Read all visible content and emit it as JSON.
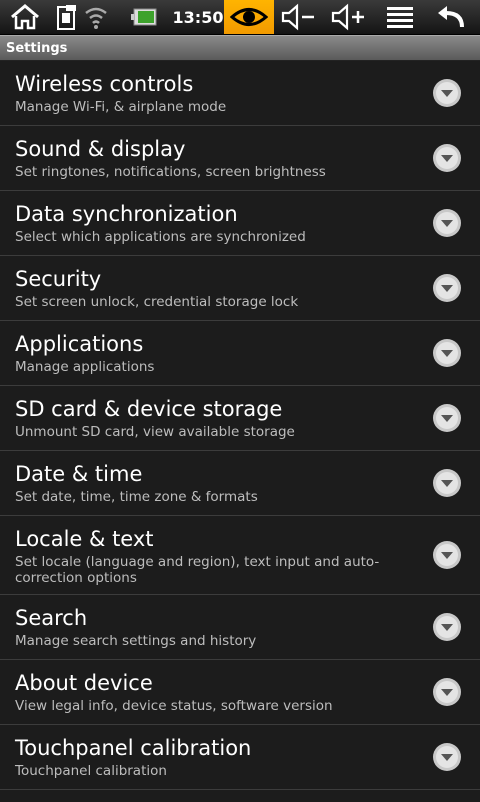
{
  "status_bar": {
    "time": "13:50",
    "icons": [
      "home-icon",
      "network-icon",
      "wifi-icon",
      "battery-icon",
      "eye-icon",
      "volume-down-icon",
      "volume-up-icon",
      "menu-icon",
      "back-icon"
    ],
    "accent": "#f5a000"
  },
  "title_bar": {
    "title": "Settings"
  },
  "settings": {
    "items": [
      {
        "title": "Wireless controls",
        "subtitle": "Manage Wi-Fi, & airplane mode"
      },
      {
        "title": "Sound & display",
        "subtitle": "Set ringtones, notifications, screen brightness"
      },
      {
        "title": "Data synchronization",
        "subtitle": "Select which applications are synchronized"
      },
      {
        "title": "Security",
        "subtitle": "Set screen unlock, credential storage lock"
      },
      {
        "title": "Applications",
        "subtitle": "Manage applications"
      },
      {
        "title": "SD card & device storage",
        "subtitle": "Unmount SD card, view available storage"
      },
      {
        "title": "Date & time",
        "subtitle": "Set date, time, time zone & formats"
      },
      {
        "title": "Locale & text",
        "subtitle": "Set locale (language and region), text input and auto-correction options"
      },
      {
        "title": "Search",
        "subtitle": "Manage search settings and history"
      },
      {
        "title": "About device",
        "subtitle": "View legal info, device status, software version"
      },
      {
        "title": "Touchpanel calibration",
        "subtitle": "Touchpanel calibration"
      }
    ]
  }
}
